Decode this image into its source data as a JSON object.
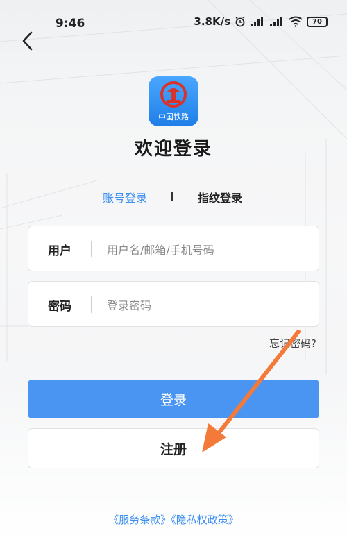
{
  "status_bar": {
    "time": "9:46",
    "net_speed": "3.8K/s",
    "battery": "70"
  },
  "logo": {
    "text": "中国铁路",
    "brand_color": "#2a86f0"
  },
  "welcome_title": "欢迎登录",
  "tabs": {
    "account_login": "账号登录",
    "fingerprint_login": "指纹登录",
    "active_color": "#3c8ef0"
  },
  "form": {
    "user_label": "用户",
    "user_placeholder": "用户名/邮箱/手机号码",
    "password_label": "密码",
    "password_placeholder": "登录密码"
  },
  "forgot_password": "忘记密码?",
  "buttons": {
    "login": "登录",
    "register": "注册",
    "login_color": "#4a95f2"
  },
  "terms": {
    "service": "《服务条款》",
    "privacy": "《隐私权政策》"
  },
  "annotation": {
    "arrow_color": "#f47a3a"
  }
}
